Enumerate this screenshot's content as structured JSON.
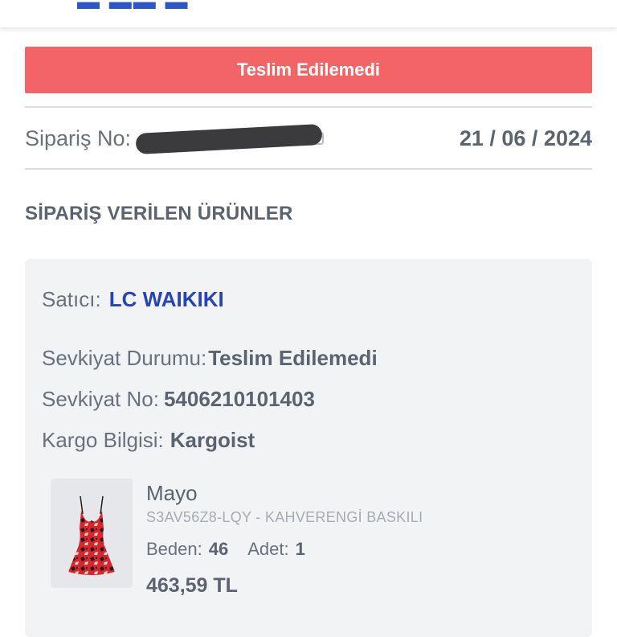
{
  "status_banner": "Teslim Edilemedi",
  "order": {
    "label": "Sipariş No:",
    "date": "21 / 06 / 2024"
  },
  "section_title": "SİPARİŞ VERİLEN ÜRÜNLER",
  "shipment": {
    "seller_label": "Satıcı:",
    "seller": "LC WAIKIKI",
    "status_label": "Sevkiyat Durumu:",
    "status": "Teslim Edilemedi",
    "shipment_no_label": "Sevkiyat No:",
    "shipment_no": "5406210101403",
    "cargo_label": "Kargo Bilgisi:",
    "cargo": "Kargoist"
  },
  "product": {
    "name": "Mayo",
    "sku": "S3AV56Z8-LQY - KAHVERENGİ BASKILI",
    "size_label": "Beden:",
    "size": "46",
    "qty_label": "Adet:",
    "qty": "1",
    "price": "463,59 TL"
  },
  "colors": {
    "banner": "#f26466",
    "brand": "#2744b7"
  },
  "icons": [
    "copy-icon"
  ]
}
